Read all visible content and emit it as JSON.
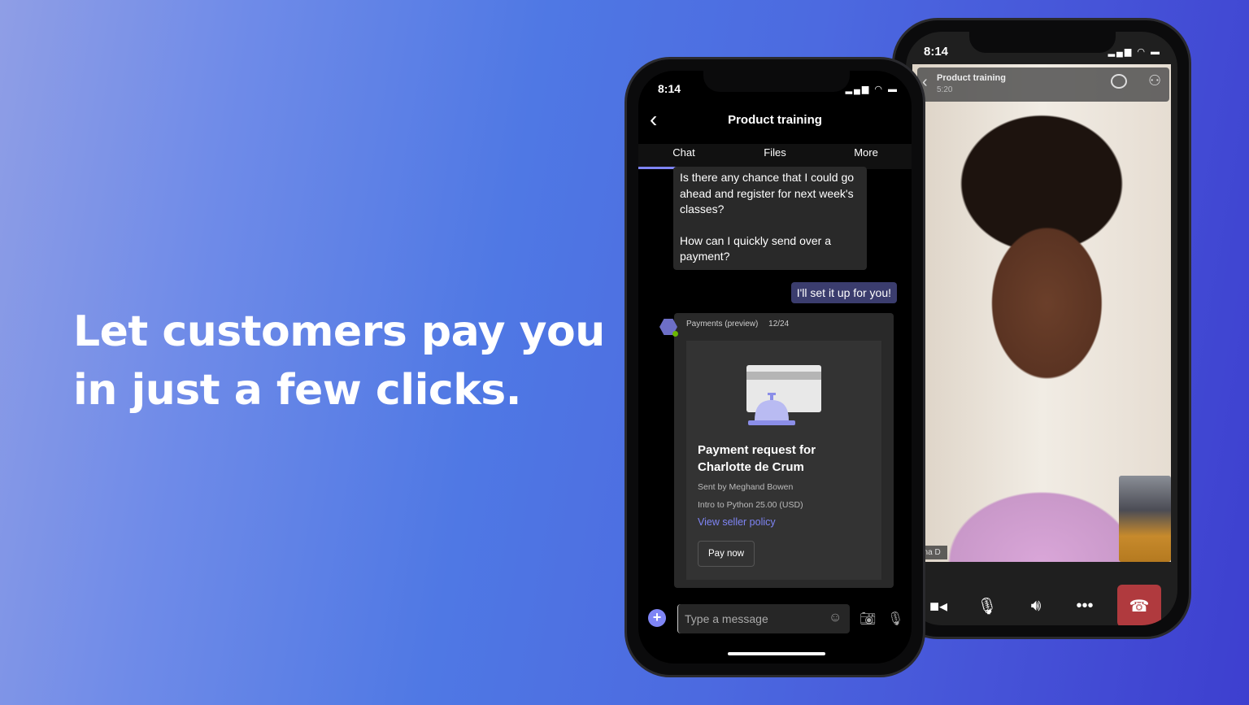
{
  "headline": {
    "line1": "Let customers pay you",
    "line2": "in just a few clicks."
  },
  "colors": {
    "accent": "#7f85f5",
    "hangup": "#b03a3e",
    "bubble_out": "#3b3d6e"
  },
  "call_phone": {
    "status_time": "8:14",
    "meeting_title": "Product training",
    "duration": "5:20",
    "participant_label": "ena D",
    "icons": [
      "chevron-left-icon",
      "chat-icon",
      "people-icon",
      "video-icon",
      "mic-icon",
      "speaker-icon",
      "more-icon",
      "hangup-icon"
    ]
  },
  "chat_phone": {
    "status_time": "8:14",
    "title": "Product training",
    "tabs": [
      {
        "label": "Chat",
        "active": true
      },
      {
        "label": "Files"
      },
      {
        "label": "More"
      }
    ],
    "incoming_message": {
      "p1": "Is there any chance that I could go ahead and register for next week's classes?",
      "p2": "How can I quickly send over a payment?"
    },
    "outgoing_message": "I'll set it up for you!",
    "card": {
      "sender": "Payments (preview)",
      "date": "12/24",
      "title": "Payment request for Charlotte de Crum",
      "sent_by": "Sent by Meghand Bowen",
      "item": "Intro to Python  25.00 (USD)",
      "link": "View seller policy",
      "button": "Pay now"
    },
    "compose_placeholder": "Type a message"
  }
}
